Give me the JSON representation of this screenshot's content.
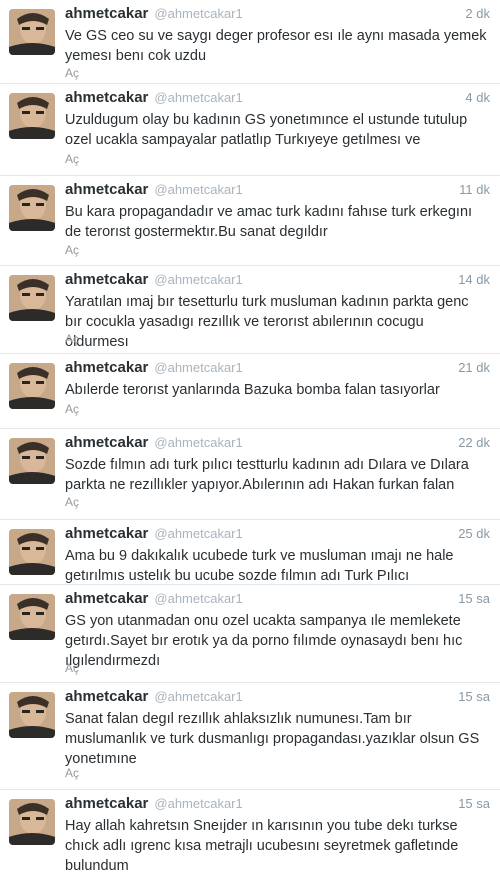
{
  "tweets": [
    {
      "username": "ahmetcakar",
      "handle": "@ahmetcakar1",
      "time": "2 dk",
      "text": "Ve GS ceo su ve saygı deger profesor esı ıle aynı masada yemek yemesı benı cok uzdu",
      "action": "Aç"
    },
    {
      "username": "ahmetcakar",
      "handle": "@ahmetcakar1",
      "time": "4 dk",
      "text": "Uzuldugum olay bu kadının GS yonetımınce el ustunde tutulup ozel ucakla sampayalar patlatlıp Turkıyeye getılmesı ve",
      "action": "Aç"
    },
    {
      "username": "ahmetcakar",
      "handle": "@ahmetcakar1",
      "time": "11 dk",
      "text": "Bu kara propagandadır ve amac turk kadını fahıse turk erkegını de terorıst gostermektır.Bu sanat degıldır",
      "action": "Aç"
    },
    {
      "username": "ahmetcakar",
      "handle": "@ahmetcakar1",
      "time": "14 dk",
      "text": "Yaratılan ımaj bır tesetturlu turk musluman kadının parkta genc bır cocukla yasadıgı rezıllık ve terorıst abılerının cocugu oldurmesı",
      "action": "Aç"
    },
    {
      "username": "ahmetcakar",
      "handle": "@ahmetcakar1",
      "time": "21 dk",
      "text": "Abılerde terorıst yanlarında Bazuka bomba falan tasıyorlar",
      "action": "Aç"
    },
    {
      "username": "ahmetcakar",
      "handle": "@ahmetcakar1",
      "time": "22 dk",
      "text": "Sozde fılmın adı turk pılıcı testturlu kadının adı Dılara ve Dılara parkta ne rezıllıkler yapıyor.Abılerının adı Hakan furkan falan",
      "action": "Aç"
    },
    {
      "username": "ahmetcakar",
      "handle": "@ahmetcakar1",
      "time": "25 dk",
      "text": "Ama bu 9 dakıkalık ucubede turk ve musluman ımajı ne hale getırılmıs ustelık bu ucube sozde fılmın adı Turk Pılıcı",
      "action": ""
    },
    {
      "username": "ahmetcakar",
      "handle": "@ahmetcakar1",
      "time": "15 sa",
      "text": "GS yon utanmadan onu ozel ucakta sampanya ıle memlekete getırdı.Sayet bır erotık ya da porno fılımde oynasaydı benı hıc ılgılendırmezdı",
      "action": "Aç"
    },
    {
      "username": "ahmetcakar",
      "handle": "@ahmetcakar1",
      "time": "15 sa",
      "text": "Sanat falan degıl rezıllık ahlaksızlık numunesı.Tam bır muslumanlık ve turk dusmanlıgı propagandası.yazıklar olsun GS yonetımıne",
      "action": "Aç"
    },
    {
      "username": "ahmetcakar",
      "handle": "@ahmetcakar1",
      "time": "15 sa",
      "text": "Hay allah kahretsın Sneıjder ın karısının you tube dekı turkse chıck adlı ıgrenc kısa metrajlı ucubesını seyretmek gafletınde bulundum",
      "action": ""
    }
  ]
}
